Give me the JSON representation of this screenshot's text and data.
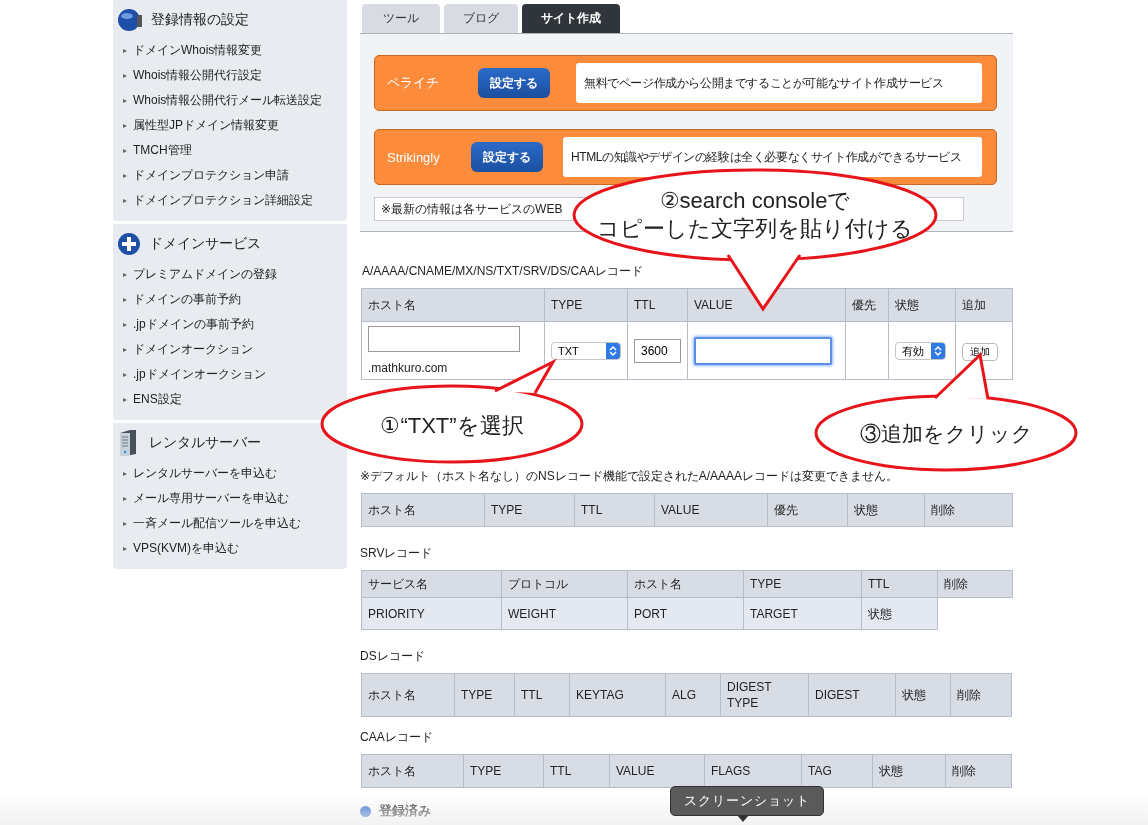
{
  "sidebar": {
    "sections": [
      {
        "kind": "globe",
        "title": "登録情報の設定",
        "items": [
          "ドメインWhois情報変更",
          "Whois情報公開代行設定",
          "Whois情報公開代行メール転送設定",
          "属性型JPドメイン情報変更",
          "TMCH管理",
          "ドメインプロテクション申請",
          "ドメインプロテクション詳細設定"
        ]
      },
      {
        "kind": "plus",
        "title": "ドメインサービス",
        "items": [
          "プレミアムドメインの登録",
          "ドメインの事前予約",
          ".jpドメインの事前予約",
          "ドメインオークション",
          ".jpドメインオークション",
          "ENS設定"
        ]
      },
      {
        "kind": "server",
        "title": "レンタルサーバー",
        "items": [
          "レンタルサーバーを申込む",
          "メール専用サーバーを申込む",
          "一斉メール配信ツールを申込む",
          "VPS(KVM)を申込む"
        ]
      }
    ]
  },
  "tabs": [
    {
      "label": "ツール",
      "selected": false
    },
    {
      "label": "ブログ",
      "selected": false
    },
    {
      "label": "サイト作成",
      "selected": true
    }
  ],
  "services": [
    {
      "name": "ペライチ",
      "button": "設定する",
      "description": "無料でページ作成から公開まですることが可能なサイト作成サービス"
    },
    {
      "name": "Strikingly",
      "button": "設定する",
      "description": "HTMLの知識やデザインの経験は全く必要なくサイト作成ができるサービス"
    }
  ],
  "services_note": "※最新の情報は各サービスのWEB",
  "record_form": {
    "title": "A/AAAA/CNAME/MX/NS/TXT/SRV/DS/CAAレコード",
    "columns": [
      "ホスト名",
      "TYPE",
      "TTL",
      "VALUE",
      "優先",
      "状態",
      "追加"
    ],
    "domain_suffix": ".mathkuro.com",
    "type": "TXT",
    "ttl": "3600",
    "value_focused": true,
    "status": "有効",
    "add_button": "追加"
  },
  "registered": {
    "note": "※デフォルト（ホスト名なし）のNSレコード機能で設定されたA/AAAAレコードは変更できません。",
    "columns": [
      "ホスト名",
      "TYPE",
      "TTL",
      "VALUE",
      "優先",
      "状態",
      "削除"
    ]
  },
  "srv": {
    "title": "SRVレコード",
    "rows": [
      [
        "サービス名",
        "プロトコル",
        "ホスト名",
        "TYPE",
        "TTL",
        "削除"
      ],
      [
        "PRIORITY",
        "WEIGHT",
        "PORT",
        "TARGET",
        "状態"
      ]
    ]
  },
  "ds": {
    "title": "DSレコード",
    "columns": [
      "ホスト名",
      "TYPE",
      "TTL",
      "KEYTAG",
      "ALG",
      "DIGEST TYPE",
      "DIGEST",
      "状態",
      "削除"
    ]
  },
  "caa": {
    "title": "CAAレコード",
    "columns": [
      "ホスト名",
      "TYPE",
      "TTL",
      "VALUE",
      "FLAGS",
      "TAG",
      "状態",
      "削除"
    ]
  },
  "footer_heading": "登録済み",
  "tooltip": "スクリーンショット",
  "callouts": [
    {
      "lines": [
        "②search consoleで",
        "コピーした文字列を貼り付ける"
      ]
    },
    {
      "lines": [
        "①“TXT”を選択"
      ]
    },
    {
      "lines": [
        "③追加をクリック"
      ]
    }
  ]
}
